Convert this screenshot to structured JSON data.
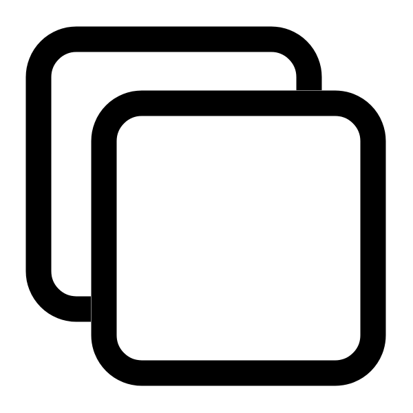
{
  "icon": {
    "name": "copy-icon",
    "stroke_color": "#000000",
    "background_color": "#ffffff"
  }
}
